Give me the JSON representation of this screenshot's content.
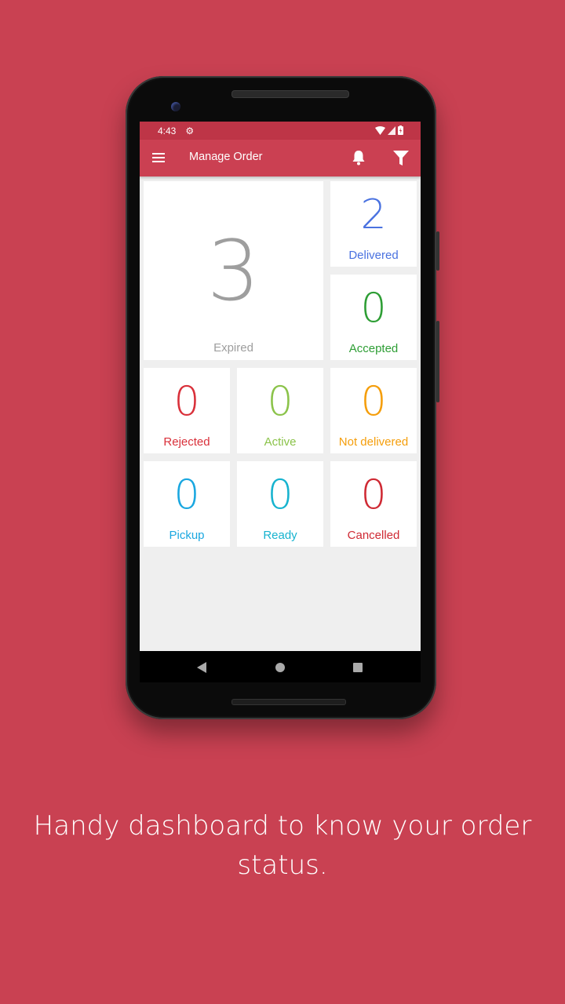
{
  "status_bar": {
    "time": "4:43",
    "icons": [
      "settings-gear-icon",
      "wifi-icon",
      "signal-icon",
      "battery-charging-icon"
    ]
  },
  "app_bar": {
    "title": "Manage Order",
    "menu_icon": "hamburger-menu-icon",
    "actions": [
      "notification-bell-icon",
      "filter-icon"
    ]
  },
  "dashboard": {
    "cards": [
      {
        "id": "expired",
        "count": "3",
        "label": "Expired",
        "color": "#9e9e9e"
      },
      {
        "id": "delivered",
        "count": "2",
        "label": "Delivered",
        "color": "#4a72e0"
      },
      {
        "id": "accepted",
        "count": "0",
        "label": "Accepted",
        "color": "#2e9e35"
      },
      {
        "id": "rejected",
        "count": "0",
        "label": "Rejected",
        "color": "#d9303a"
      },
      {
        "id": "active",
        "count": "0",
        "label": "Active",
        "color": "#8bc34a"
      },
      {
        "id": "not-delivered",
        "count": "0",
        "label": "Not delivered",
        "color": "#f59e0b"
      },
      {
        "id": "pickup",
        "count": "0",
        "label": "Pickup",
        "color": "#1aa7e0"
      },
      {
        "id": "ready",
        "count": "0",
        "label": "Ready",
        "color": "#17b3cf"
      },
      {
        "id": "cancelled",
        "count": "0",
        "label": "Cancelled",
        "color": "#cf2a34"
      }
    ]
  },
  "nav_bar": {
    "buttons": [
      "back-icon",
      "home-icon",
      "recents-icon"
    ]
  },
  "caption": "Handy dashboard to know your order status.",
  "colors": {
    "background": "#c94152",
    "app_bar": "#cb4052",
    "status_bar": "#be3547"
  }
}
